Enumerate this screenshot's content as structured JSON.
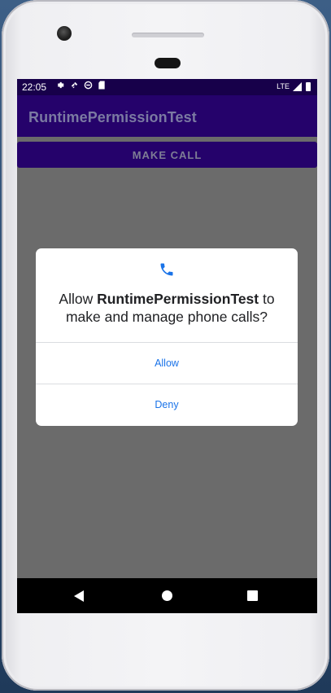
{
  "statusbar": {
    "time": "22:05",
    "network": "LTE"
  },
  "app": {
    "title": "RuntimePermissionTest",
    "make_call_label": "MAKE CALL"
  },
  "dialog": {
    "message_prefix": "Allow ",
    "app_name": "RuntimePermissionTest",
    "message_suffix_1": " to",
    "message_line_2": "make and manage phone calls?",
    "allow_label": "Allow",
    "deny_label": "Deny"
  },
  "icons": {
    "status": [
      "settings-icon",
      "satellite-icon",
      "sync-icon",
      "sd-card-icon"
    ],
    "dialog": "phone-icon",
    "nav": [
      "back-icon",
      "home-icon",
      "recents-icon"
    ]
  },
  "colors": {
    "status_bar": "#17004a",
    "app_bar": "#25026b",
    "scrim": "#6b6b6b",
    "dialog_button": "#1a73e8"
  }
}
